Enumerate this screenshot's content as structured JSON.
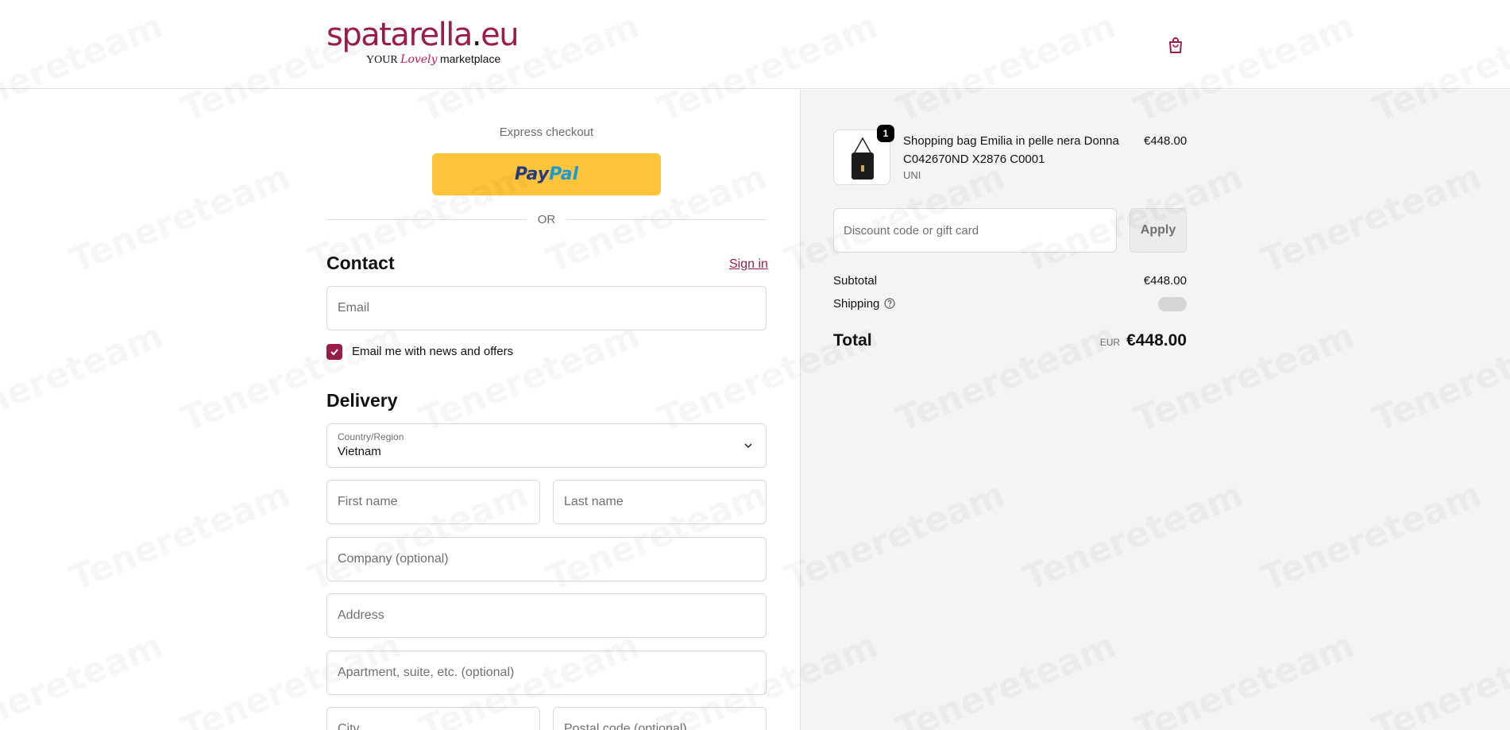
{
  "header": {
    "logo_main": "spatarella",
    "logo_dot": ".",
    "logo_tld": "eu",
    "logo_sub_pre": "YOUR",
    "logo_sub_lovely": "Lovely",
    "logo_sub_post": "marketplace",
    "bag_icon": "shopping-bag-icon"
  },
  "express": {
    "label": "Express checkout",
    "paypal_pay": "Pay",
    "paypal_pal": "Pal",
    "or": "OR"
  },
  "contact": {
    "title": "Contact",
    "sign_in": "Sign in",
    "email_placeholder": "Email",
    "newsletter_label": "Email me with news and offers",
    "newsletter_checked": true
  },
  "delivery": {
    "title": "Delivery",
    "country_label": "Country/Region",
    "country_value": "Vietnam",
    "first_name_placeholder": "First name",
    "last_name_placeholder": "Last name",
    "company_placeholder": "Company (optional)",
    "address_placeholder": "Address",
    "apartment_placeholder": "Apartment, suite, etc. (optional)",
    "city_placeholder": "City",
    "postal_placeholder": "Postal code (optional)"
  },
  "summary": {
    "product": {
      "quantity": "1",
      "name": "Shopping bag Emilia in pelle nera Donna C042670ND X2876 C0001",
      "variant": "UNI",
      "price": "€448.00"
    },
    "discount_placeholder": "Discount code or gift card",
    "apply_label": "Apply",
    "subtotal_label": "Subtotal",
    "subtotal_value": "€448.00",
    "shipping_label": "Shipping",
    "total_label": "Total",
    "total_currency": "EUR",
    "total_value": "€448.00"
  },
  "watermark": "Tenereteam",
  "colors": {
    "brand": "#9b1d4a",
    "paypal_yellow": "#ffc439",
    "summary_bg": "#f4f4f4"
  }
}
